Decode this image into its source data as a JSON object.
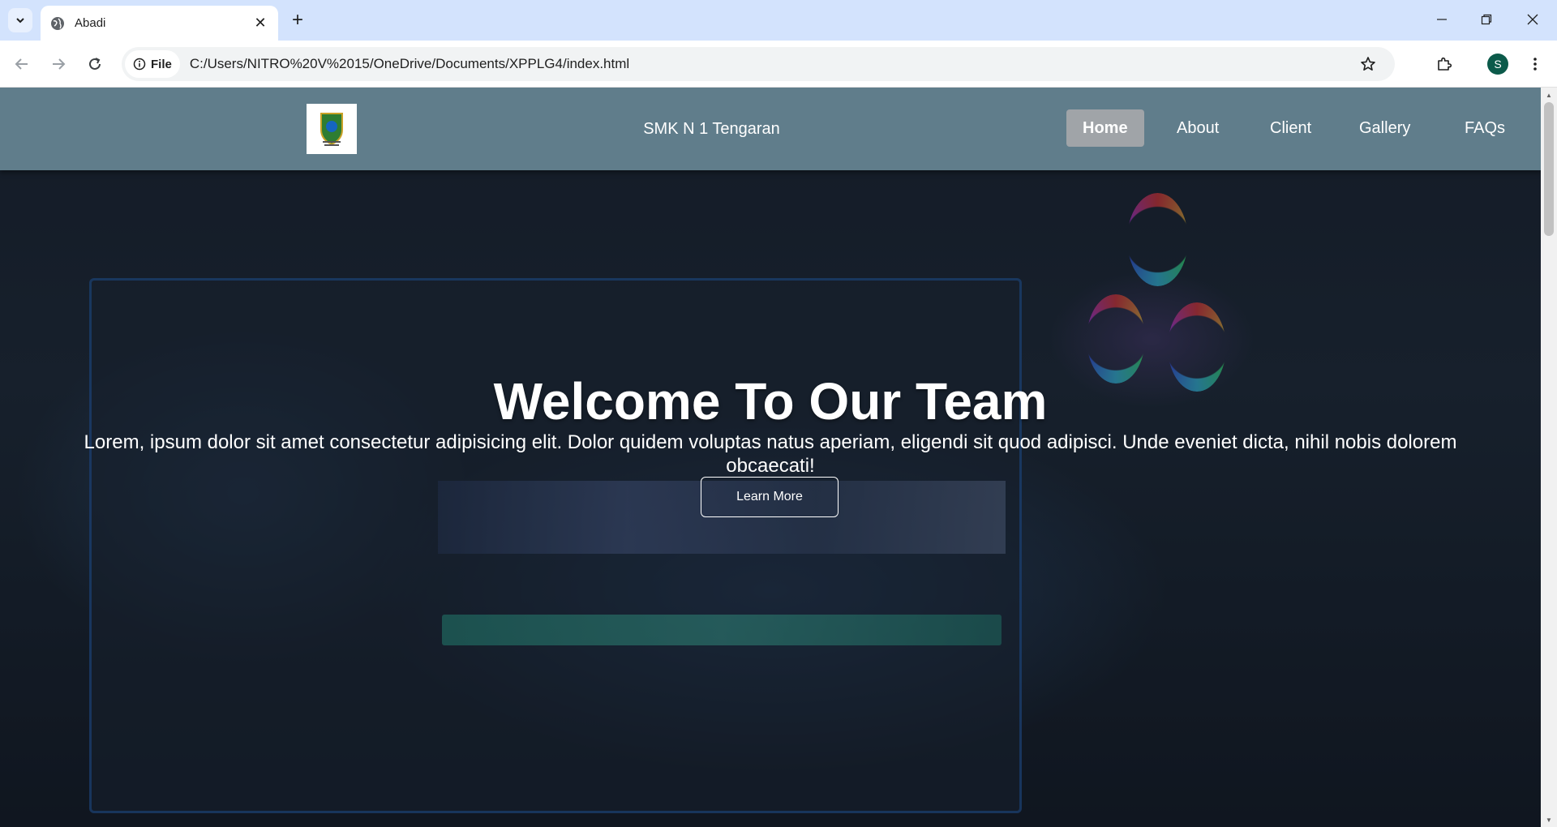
{
  "browser": {
    "tab_title": "Abadi",
    "url_scheme_label": "File",
    "url": "C:/Users/NITRO%20V%2015/OneDrive/Documents/XPPLG4/index.html",
    "profile_initial": "S"
  },
  "site": {
    "name": "SMK N 1 Tengaran",
    "nav": [
      {
        "label": "Home",
        "active": true
      },
      {
        "label": "About",
        "active": false
      },
      {
        "label": "Client",
        "active": false
      },
      {
        "label": "Gallery",
        "active": false
      },
      {
        "label": "FAQs",
        "active": false
      }
    ]
  },
  "hero": {
    "title": "Welcome To Our Team",
    "text": "Lorem, ipsum dolor sit amet consectetur adipisicing elit. Dolor quidem voluptas natus aperiam, eligendi sit quod adipisci. Unde eveniet dicta, nihil nobis dolorem obcaecati!",
    "button_label": "Learn More"
  },
  "colors": {
    "navbar_bg": "#607d8b",
    "active_nav_bg": "#a0a4a8",
    "tabstrip_bg": "#d3e3fd"
  }
}
